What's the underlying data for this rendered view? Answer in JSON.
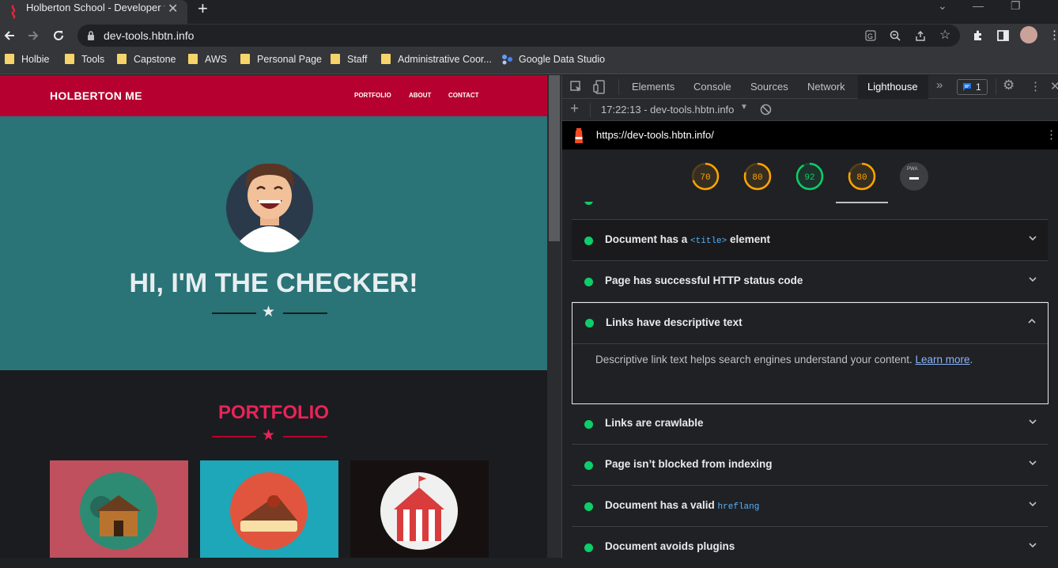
{
  "browser": {
    "tab_title": "Holberton School - Developer tools",
    "new_tab": "+",
    "url": "dev-tools.hbtn.info",
    "bookmarks": [
      {
        "label": "Holbie"
      },
      {
        "label": "Tools"
      },
      {
        "label": "Capstone"
      },
      {
        "label": "AWS"
      },
      {
        "label": "Personal Page"
      },
      {
        "label": "Staff"
      },
      {
        "label": "Administrative Coor..."
      },
      {
        "label": "Google Data Studio"
      }
    ]
  },
  "site": {
    "brand": "HOLBERTON ME",
    "nav": [
      "PORTFOLIO",
      "ABOUT",
      "CONTACT"
    ],
    "hero_title": "HI, I'M THE CHECKER!",
    "portfolio_title": "PORTFOLIO",
    "colors": {
      "nav": "#b6002f",
      "hero": "#2a7377",
      "accent": "#e8245a"
    }
  },
  "devtools": {
    "tabs": [
      "Elements",
      "Console",
      "Sources",
      "Network",
      "Lighthouse"
    ],
    "active_tab": "Lighthouse",
    "issues_count": "1",
    "report_label": "17:22:13 - dev-tools.hbtn.info",
    "report_url": "https://dev-tools.hbtn.info/",
    "scores": [
      {
        "value": 70,
        "label": "70",
        "color": "#ffa400"
      },
      {
        "value": 80,
        "label": "80",
        "color": "#ffa400"
      },
      {
        "value": 92,
        "label": "92",
        "color": "#0cce6b"
      },
      {
        "value": 80,
        "label": "80",
        "color": "#ffa400"
      }
    ],
    "pwa_label": "PWA",
    "audits": [
      {
        "pre": "Document has a ",
        "code": "<title>",
        "post": " element"
      },
      {
        "pre": "Page has successful HTTP status code",
        "code": "",
        "post": ""
      },
      {
        "pre": "Links have descriptive text",
        "code": "",
        "post": ""
      },
      {
        "pre": "Links are crawlable",
        "code": "",
        "post": ""
      },
      {
        "pre": "Page isn’t blocked from indexing",
        "code": "",
        "post": ""
      },
      {
        "pre": "Document has a valid ",
        "code": "hreflang",
        "post": ""
      },
      {
        "pre": "Document avoids plugins",
        "code": "",
        "post": ""
      }
    ],
    "expanded_description": "Descriptive link text helps search engines understand your content.",
    "learn_more": "Learn more",
    "period": "."
  }
}
